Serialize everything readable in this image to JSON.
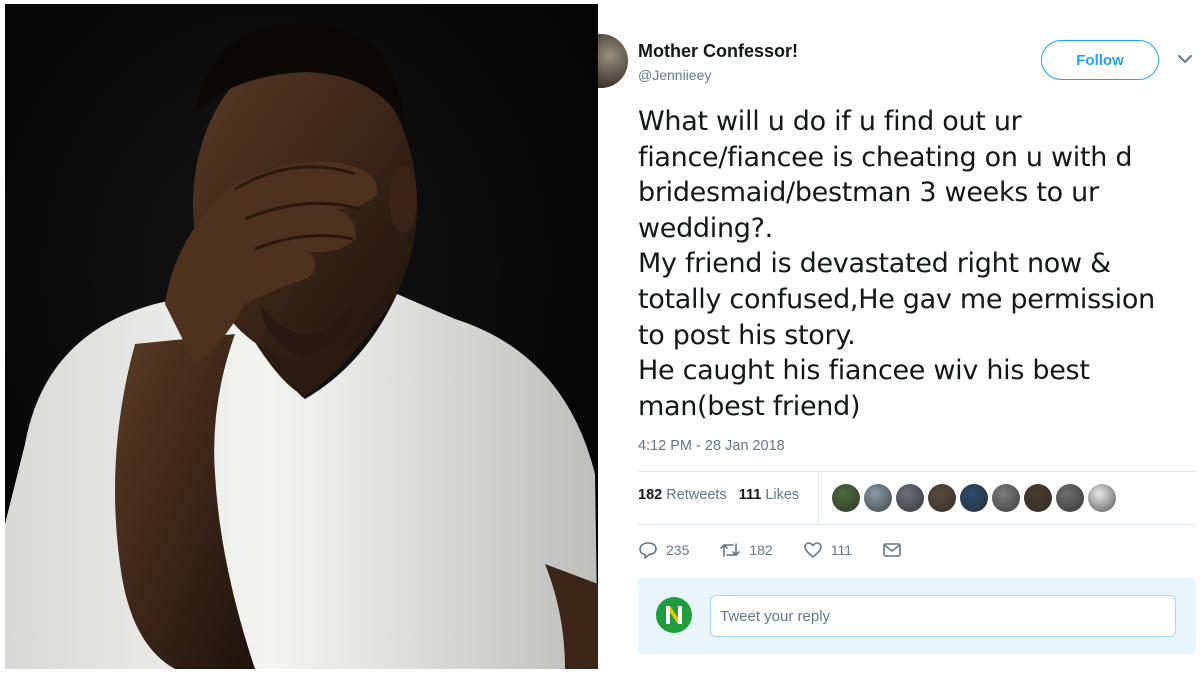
{
  "tweet": {
    "author_name": "Mother Confessor!",
    "author_handle": "@Jenniieey",
    "follow_label": "Follow",
    "text": "What will u do if u find out ur\nfiance/fiancee is cheating on u with d\nbridesmaid/bestman 3 weeks to ur\nwedding?.\nMy friend is devastated right now &\ntotally confused,He gav me permission\nto post his story.\nHe caught his fiancee wiv his best\nman(best friend)",
    "timestamp": "4:12 PM - 28 Jan 2018",
    "retweets_count": "182",
    "retweets_label": "Retweets",
    "likes_count": "111",
    "likes_label": "Likes",
    "liker_avatar_colors": [
      "#4a6b3a",
      "#8a9aa8",
      "#6b6f7a",
      "#5a4a3c",
      "#2d4a6e",
      "#7d7d7d",
      "#4a3a2c",
      "#6d6d6d",
      "#e8e8e8"
    ],
    "actions": {
      "reply_count": "235",
      "retweet_count": "182",
      "like_count": "111"
    },
    "reply_placeholder": "Tweet your reply",
    "colors": {
      "accent": "#1da1f2",
      "muted": "#657786",
      "reply_bg": "#e8f5fd",
      "brand_green": "#1f9e3e"
    }
  },
  "icons": [
    "chevron-down-icon",
    "reply-icon",
    "retweet-icon",
    "like-icon",
    "message-icon"
  ]
}
